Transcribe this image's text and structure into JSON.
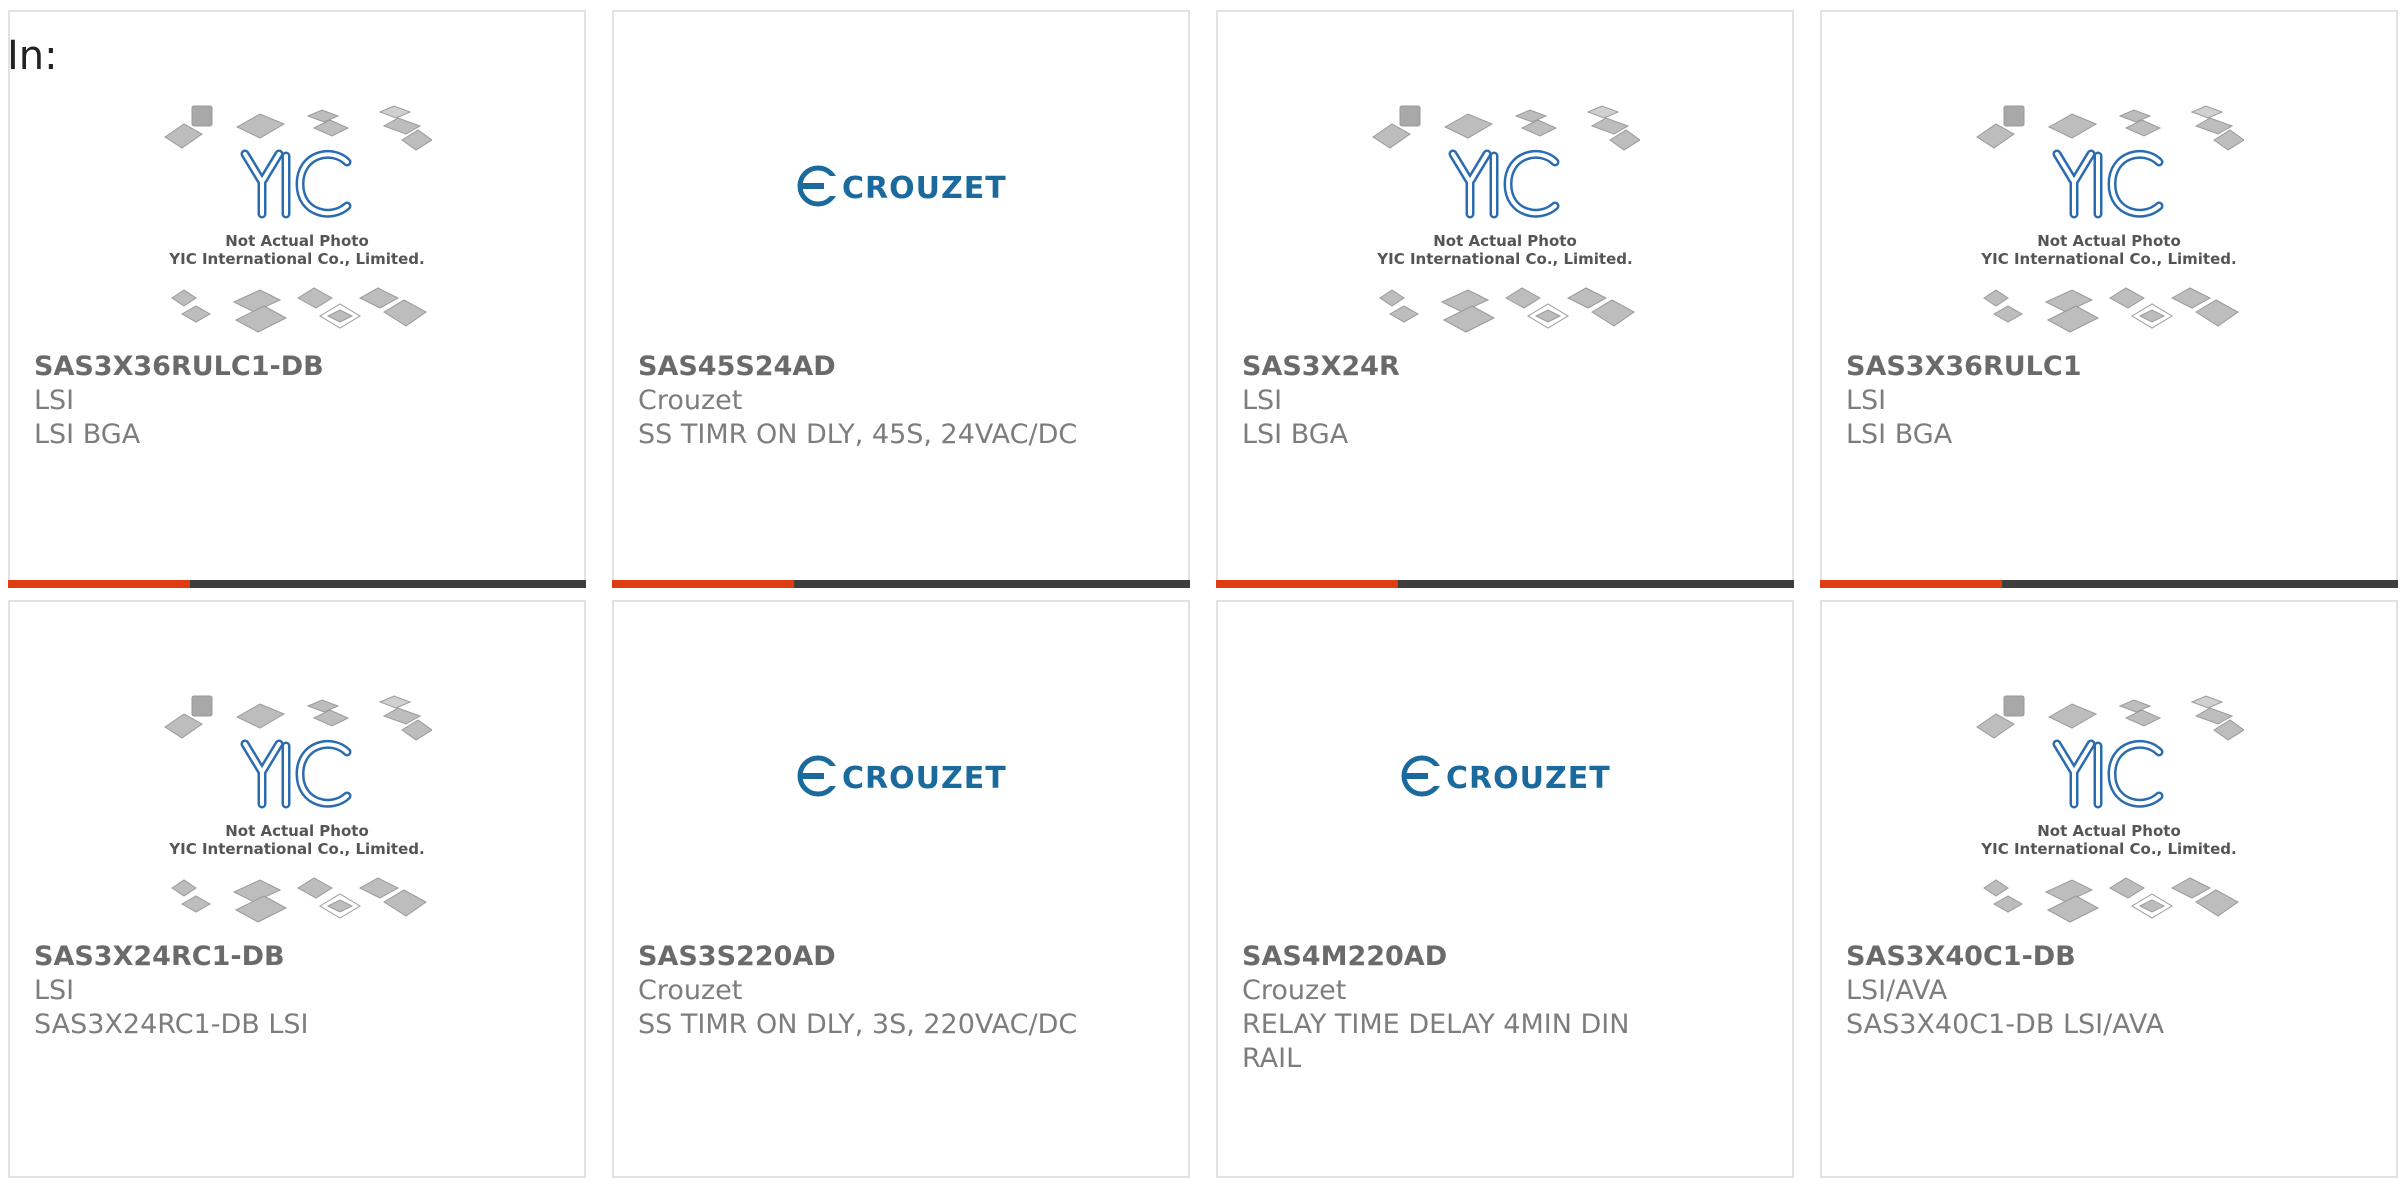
{
  "header": {
    "label": "In:"
  },
  "brand": {
    "accent": "#e03c12",
    "bar": "#3e3e3e",
    "crouzet_blue": "#1a6a9e",
    "yic_blue": "#2b6cb0"
  },
  "yic_logo": {
    "mark": "YIC",
    "line1": "Not Actual Photo",
    "line2": "YIC International Co., Limited."
  },
  "crouzet_logo": {
    "text": "CROUZET"
  },
  "products": [
    {
      "part": "SAS3X36RULC1-DB",
      "mfr": "LSI",
      "desc": "LSI BGA",
      "image": "yic"
    },
    {
      "part": "SAS45S24AD",
      "mfr": "Crouzet",
      "desc": "SS TIMR ON DLY, 45S, 24VAC/DC",
      "image": "crouzet"
    },
    {
      "part": "SAS3X24R",
      "mfr": "LSI",
      "desc": "LSI BGA",
      "image": "yic"
    },
    {
      "part": "SAS3X36RULC1",
      "mfr": "LSI",
      "desc": "LSI BGA",
      "image": "yic"
    },
    {
      "part": "SAS3X24RC1-DB",
      "mfr": "LSI",
      "desc": "SAS3X24RC1-DB LSI",
      "image": "yic"
    },
    {
      "part": "SAS3S220AD",
      "mfr": "Crouzet",
      "desc": "SS TIMR ON DLY, 3S, 220VAC/DC",
      "image": "crouzet"
    },
    {
      "part": "SAS4M220AD",
      "mfr": "Crouzet",
      "desc": "RELAY TIME DELAY 4MIN DIN RAIL",
      "image": "crouzet"
    },
    {
      "part": "SAS3X40C1-DB",
      "mfr": "LSI/AVA",
      "desc": "SAS3X40C1-DB LSI/AVA",
      "image": "yic"
    }
  ]
}
